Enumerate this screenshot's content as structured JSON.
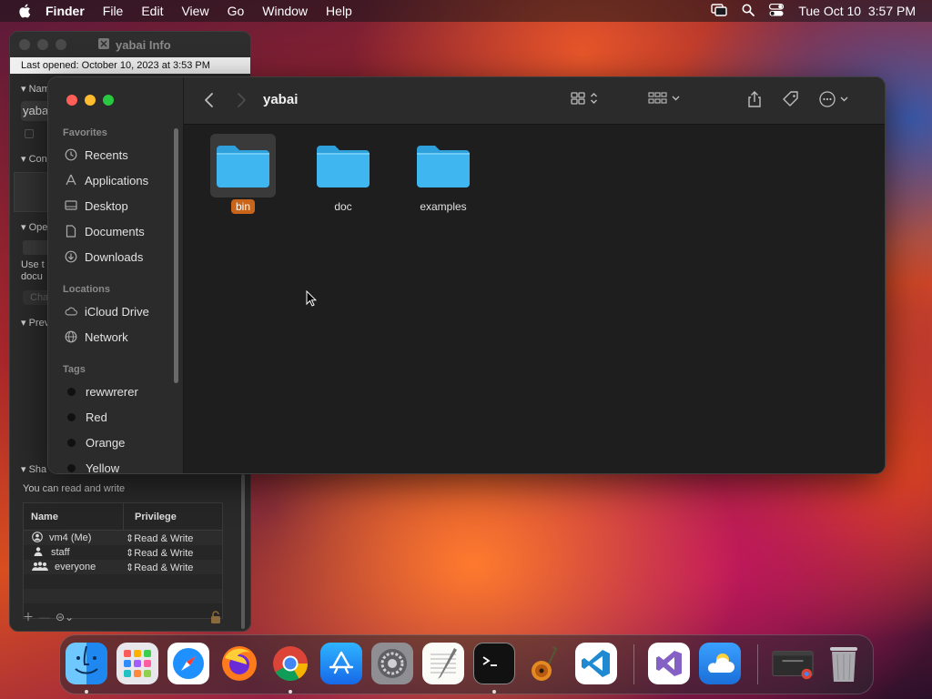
{
  "menubar": {
    "app": "Finder",
    "items": [
      "File",
      "Edit",
      "View",
      "Go",
      "Window",
      "Help"
    ],
    "clock": "Tue Oct 10  3:57 PM"
  },
  "info_window": {
    "title": "yabai Info",
    "last_opened": "Last opened: October 10, 2023 at 3:53 PM",
    "sections": {
      "name": "Nam",
      "name_field": "yaba",
      "comments": "Con",
      "open_with": "Ope",
      "use_text_1": "Use t",
      "use_text_2": "docu",
      "change_btn": "Cha",
      "preview": "Prev",
      "sharing": "Sha"
    },
    "sharing_summary": "You can read and write",
    "perm_headers": {
      "name": "Name",
      "privilege": "Privilege"
    },
    "perm_rows": [
      {
        "name": "vm4 (Me)",
        "privilege": "Read & Write"
      },
      {
        "name": "staff",
        "privilege": "Read & Write"
      },
      {
        "name": "everyone",
        "privilege": "Read & Write"
      }
    ]
  },
  "finder": {
    "title": "yabai",
    "sidebar": {
      "favorites_header": "Favorites",
      "favorites": [
        "Recents",
        "Applications",
        "Desktop",
        "Documents",
        "Downloads"
      ],
      "locations_header": "Locations",
      "locations": [
        "iCloud Drive",
        "Network"
      ],
      "tags_header": "Tags",
      "tags": [
        "rewwrerer",
        "Red",
        "Orange",
        "Yellow"
      ]
    },
    "folders": [
      {
        "name": "bin",
        "selected": true
      },
      {
        "name": "doc",
        "selected": false
      },
      {
        "name": "examples",
        "selected": false
      }
    ]
  },
  "dock": {
    "apps": [
      "Finder",
      "Launchpad",
      "Safari",
      "Firefox",
      "Chrome",
      "App Store",
      "System Settings",
      "TextEdit",
      "Terminal",
      "GarageBand",
      "Visual Studio Code",
      "Visual Studio",
      "Weather",
      "Chrome Window",
      "Trash"
    ]
  },
  "colors": {
    "accent_selection": "#c8651b",
    "folder_blue": "#3fb6f0"
  }
}
